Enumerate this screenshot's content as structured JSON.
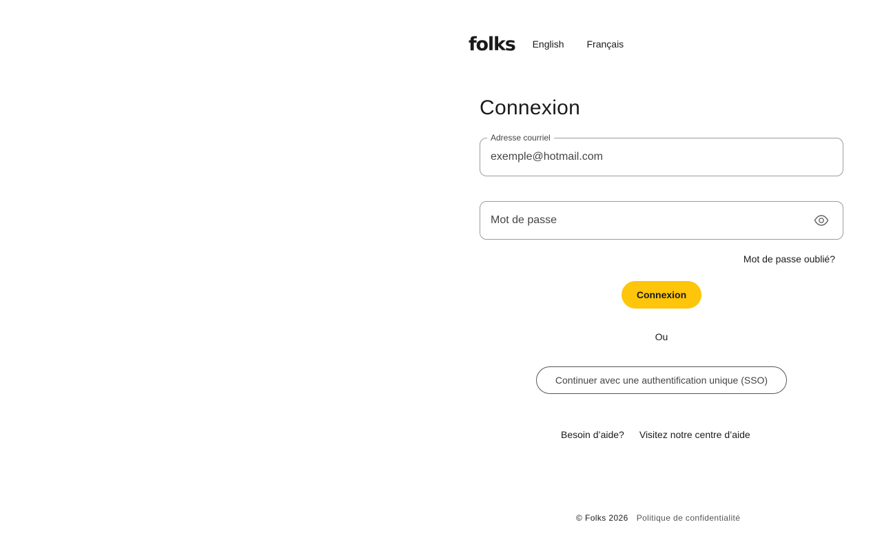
{
  "header": {
    "logo_text": "folks",
    "languages": [
      {
        "label": "English"
      },
      {
        "label": "Français"
      }
    ]
  },
  "form": {
    "title": "Connexion",
    "email": {
      "label": "Adresse courriel",
      "value": "exemple@hotmail.com"
    },
    "password": {
      "placeholder": "Mot de passe",
      "toggle_icon": "eye-icon"
    },
    "forgot_label": "Mot de passe oublié?",
    "submit_label": "Connexion",
    "or_label": "Ou",
    "sso_label": "Continuer avec une authentification unique (SSO)"
  },
  "help": {
    "question": "Besoin d’aide?",
    "link_label": "Visitez notre centre d’aide"
  },
  "footer": {
    "copyright": "© Folks 2026",
    "privacy_label": "Politique de confidentialité"
  },
  "colors": {
    "accent": "#fec50a",
    "text": "#1a1a1a",
    "border": "#9b9b9b"
  }
}
